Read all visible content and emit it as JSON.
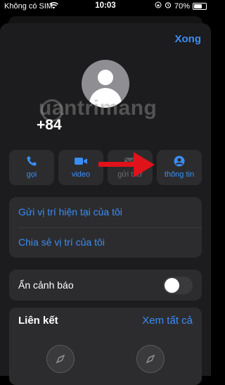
{
  "status": {
    "carrier": "Không có SIM",
    "time": "10:03",
    "battery": "70%"
  },
  "header": {
    "done_label": "Xong"
  },
  "contact": {
    "phone": "+84"
  },
  "watermark": {
    "text": "uantrimang"
  },
  "actions": [
    {
      "label": "gọi",
      "icon": "phone-icon"
    },
    {
      "label": "video",
      "icon": "video-icon"
    },
    {
      "label": "gửi thư",
      "icon": "mail-icon"
    },
    {
      "label": "thông tin",
      "icon": "person-icon"
    }
  ],
  "location": {
    "share_current": "Gửi vị trí hiện tại của tôi",
    "share_live": "Chia sẻ vị trí của tôi"
  },
  "alerts": {
    "hide_alerts_label": "Ẩn cảnh báo",
    "hide_alerts_on": false
  },
  "links": {
    "title": "Liên kết",
    "see_all": "Xem tất cả"
  },
  "colors": {
    "accent": "#3a8ef6",
    "background": "#1c1c1e",
    "card": "#2c2c2e",
    "arrow": "#e0121a"
  }
}
